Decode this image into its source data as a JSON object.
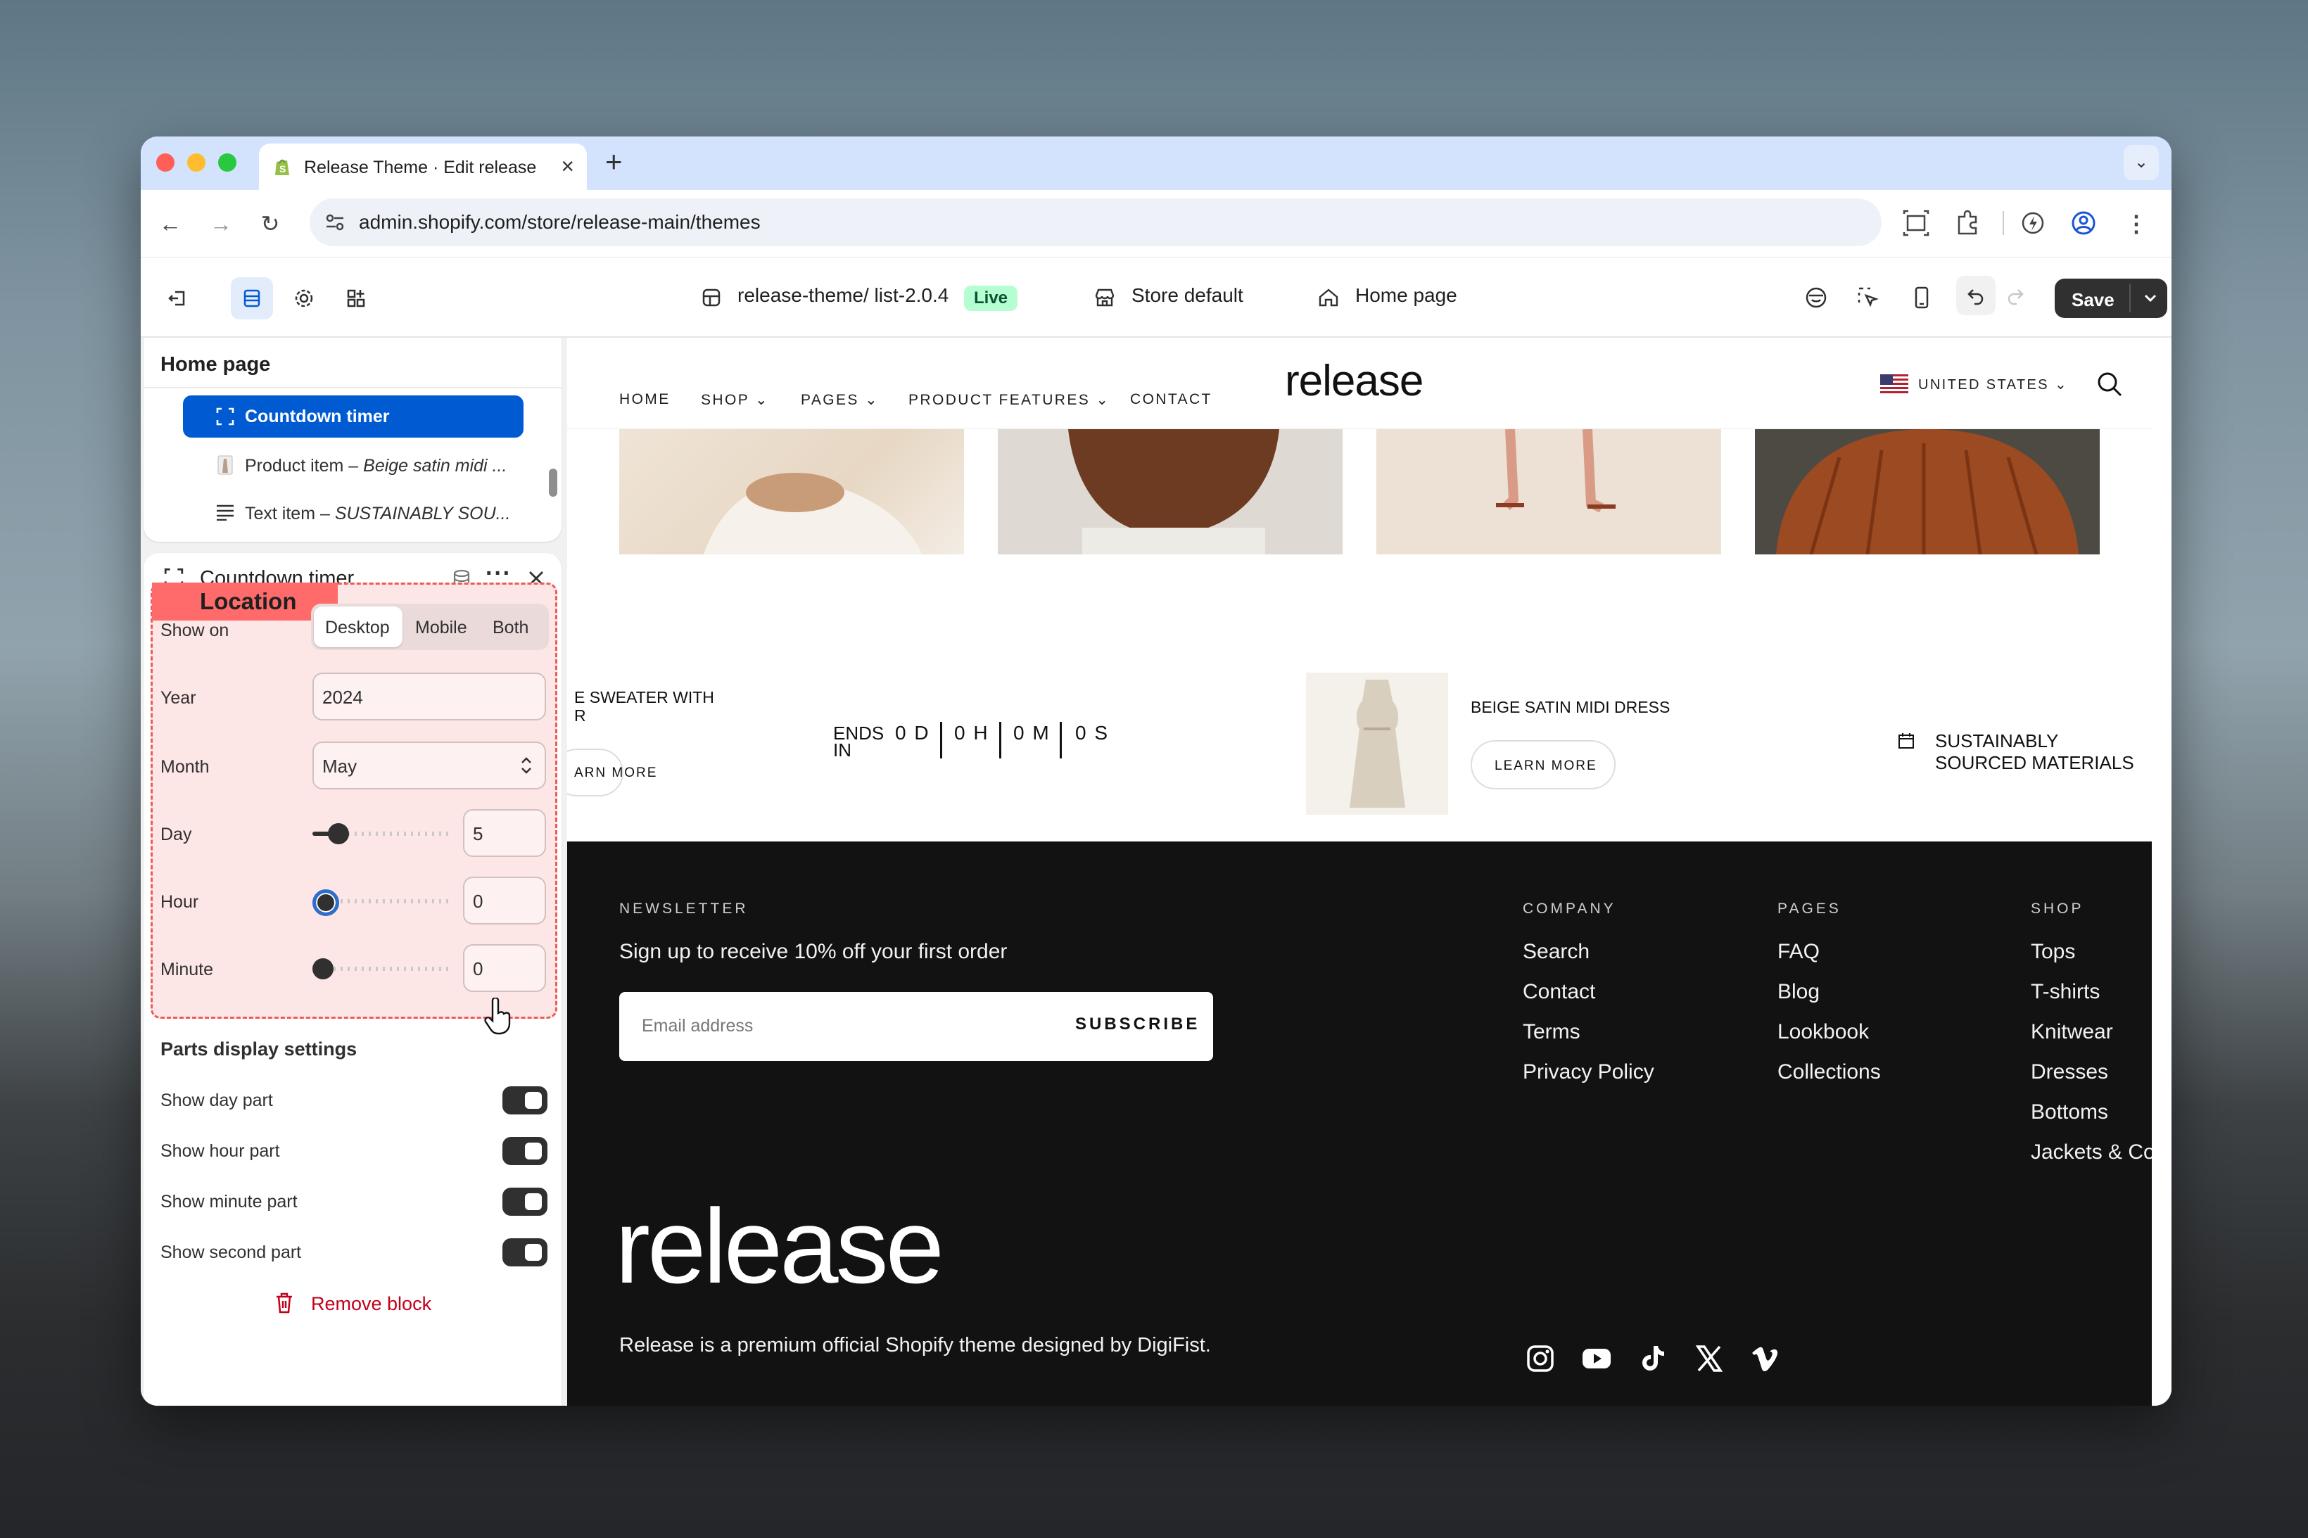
{
  "browser": {
    "tab_title": "Release Theme · Edit release-main",
    "url": "admin.shopify.com/store/release-main/themes"
  },
  "toolbar": {
    "theme_name": "release-theme/ list-2.0.4",
    "live_badge": "Live",
    "store_default": "Store default",
    "home_page": "Home page",
    "save_label": "Save"
  },
  "sidebar": {
    "section_title": "Home page",
    "tree": [
      {
        "label": "Countdown timer",
        "detail": ""
      },
      {
        "label": "Product item",
        "detail": " – Beige satin midi ..."
      },
      {
        "label": "Text item",
        "detail": " – SUSTAINABLY SOU..."
      }
    ],
    "block_title": "Countdown timer",
    "location_badge": "Location",
    "show_on": {
      "label": "Show on",
      "options": [
        "Desktop",
        "Mobile",
        "Both"
      ],
      "selected": "Desktop"
    },
    "year": {
      "label": "Year",
      "value": "2024"
    },
    "month": {
      "label": "Month",
      "value": "May"
    },
    "day": {
      "label": "Day",
      "value": "5",
      "fraction": 0.13
    },
    "hour": {
      "label": "Hour",
      "value": "0",
      "fraction": 0
    },
    "minute": {
      "label": "Minute",
      "value": "0",
      "fraction": 0
    },
    "parts_title": "Parts display settings",
    "toggles": [
      {
        "label": "Show day part",
        "on": true
      },
      {
        "label": "Show hour part",
        "on": true
      },
      {
        "label": "Show minute part",
        "on": true
      },
      {
        "label": "Show second part",
        "on": true
      }
    ],
    "remove_label": "Remove block"
  },
  "store": {
    "nav": [
      "HOME",
      "SHOP",
      "PAGES",
      "PRODUCT FEATURES",
      "CONTACT"
    ],
    "logo": "release",
    "country": "UNITED STATES",
    "sweater_line1": "E SWEATER WITH",
    "sweater_line2": "R",
    "learn_more_partial": "ARN MORE",
    "ends_line1": "ENDS",
    "ends_line2": "IN",
    "countdown": [
      "0 D",
      "0 H",
      "0 M",
      "0 S"
    ],
    "product_title": "BEIGE SATIN MIDI DRESS",
    "learn_more": "LEARN MORE",
    "sustain_text": "SUSTAINABLY SOURCED MATERIALS"
  },
  "footer": {
    "newsletter_heading": "NEWSLETTER",
    "newsletter_text": "Sign up to receive 10% off your first order",
    "email_placeholder": "Email address",
    "subscribe": "SUBSCRIBE",
    "columns": [
      {
        "heading": "COMPANY",
        "links": [
          "Search",
          "Contact",
          "Terms",
          "Privacy Policy"
        ]
      },
      {
        "heading": "PAGES",
        "links": [
          "FAQ",
          "Blog",
          "Lookbook",
          "Collections"
        ]
      },
      {
        "heading": "SHOP",
        "links": [
          "Tops",
          "T-shirts",
          "Knitwear",
          "Dresses",
          "Bottoms",
          "Jackets & Coats"
        ]
      }
    ],
    "logo": "release",
    "tagline": "Release is a premium official Shopify theme designed by DigiFist.",
    "social": [
      "instagram-icon",
      "youtube-icon",
      "tiktok-icon",
      "x-icon",
      "vimeo-icon"
    ]
  },
  "colors": {
    "accent": "#005bd3",
    "location": "#ff6b6b",
    "live": "#b4fed2",
    "remove": "#c2001a"
  }
}
